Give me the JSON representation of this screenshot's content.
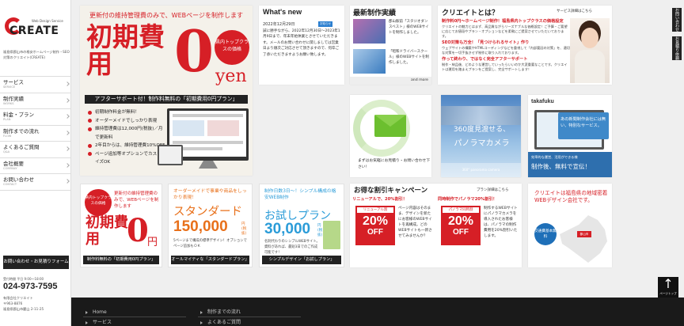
{
  "sidebar": {
    "logo_small": "Web Design Service",
    "logo_word": "CREATE",
    "tagline": "福島県郡山市の格安ホームページ制作・SEO対策のクリエイト(CREATE)",
    "nav": [
      {
        "jp": "サービス",
        "en": "SERVICE"
      },
      {
        "jp": "制作実績",
        "en": "WORKS"
      },
      {
        "jp": "料金・プラン",
        "en": "PLAN"
      },
      {
        "jp": "制作までの流れ",
        "en": "FLOW"
      },
      {
        "jp": "よくあるご質問",
        "en": "Q&A"
      },
      {
        "jp": "会社概要",
        "en": "COMPANY"
      },
      {
        "jp": "お問い合わせ",
        "en": "CONTACT"
      }
    ],
    "contact_button": "お問い合わせ・お見積りフォーム",
    "tel_hours": "受付時間 平日 9:00～18:00",
    "tel_number": "024-973-7595",
    "address": [
      "有限会社クリエイト",
      "〒963-8876",
      "福島県郡山市麓山 2-11-25"
    ]
  },
  "right_rail": {
    "tab1": "お問い合わせ",
    "tab2": "お見積り依頼",
    "pagetop_label": "ページトップ"
  },
  "hero": {
    "top": "更新付の維持管理費のみで、WEBページを制作します",
    "big": "初期費用",
    "zero": "0",
    "yen": "yen",
    "badge": "県内トップクラスの価格",
    "band": "アフターサポート付！制作料無料の「初期費用0円プラン」",
    "list": [
      "初期制作料金が無料！",
      "オーダーメイドでしっかり表現",
      "維持管理費は12,000円(税抜)／月で更新料",
      "2年目からは、維持管理費10%OFF",
      "ページ追加等オプションでカスタマイズOK"
    ]
  },
  "news": {
    "title": "What's new",
    "date": "2022年12月29日",
    "tag": "お知らせ",
    "body": "誠に勝手ながら、2022年12月30日～2023年1月9日まで、年末年始休業とさせていただきます。メールのお問い合わせに関しましては営業日より順次ご対応させて頂きますので、何卒ご了承いただきますようお願い致します。"
  },
  "works": {
    "title": "最新制作実績",
    "items": [
      "郡山駅前「スタジオダンスベスト」様のWEBサイトを制作しました。",
      "「昭和ドライバースクール」様のWEBサイトを制作しました。"
    ],
    "more": "and more"
  },
  "client": {
    "title": "クリエイトとは？",
    "link": "サービス詳細はこちら",
    "items": [
      {
        "h": "制作料0円～ホームページ制作！福島県内トップクラスの価格設定",
        "b": "クリエイトの魅力とはまず、高品質ながらリーズナブルな価格設定！ご予算・ご要望に応じてお値段やプラン・オプションなどを柔軟にご提案させていただいております。"
      },
      {
        "h": "SEO対策も万全！「見つけられるサイト」作り",
        "b": "ウェブサイトの構築やHTMLコーディングなどを重視して「内部要因の対策」を、適切な対策を一切手抜きせず制作に取り入れております。"
      },
      {
        "h": "作って終わり、ではなく完全アフターサポート",
        "b": "制作・納品後、どのような運営していったらいいのか大変重要なことです。クリエイトは運用を踏まえプランをご提案し、完全サポートします！"
      }
    ]
  },
  "mail": {
    "text": "まずはお気軽にお見積り・お問い合わせ下さい！"
  },
  "pano": {
    "line1": "360度見渡せる、",
    "line2": "パノラマカメラ",
    "foot": "360° panorama camera"
  },
  "takafuku": {
    "logo": "takafuku",
    "badge": "あの新聞制作会社には無い、特別なサービス。",
    "foot_small": "効率的な運営、活用ができる様",
    "foot_big": "制作後、無料で宣伝！"
  },
  "plans": {
    "p1": {
      "badge": "県内トップクラスの価格",
      "top": "更新付の維持管理費のみで、WEBページを制作します",
      "big": "初期費用",
      "zero": "0",
      "yen": "円",
      "foot": "制作料無料の「初期費用0円プラン」"
    },
    "p2": {
      "top": "オーダーメイドで事業や商品をしっかり表現！",
      "name": "スタンダード",
      "price": "150,000",
      "unit": "円(税抜)",
      "desc": "5ページまで構成の標準デザイン！オプションでページ追加もＯＫ",
      "foot": "オールマイティな「スタンダードプラン」"
    },
    "p3": {
      "top": "制作日数3日～！シンプル構成の格安WEB制作",
      "name": "お試しプラン",
      "price": "30,000",
      "unit": "円(税抜)",
      "desc": "名刺代わりのシンプルWEBサイト。資料があれば、最短3日でのご作成可能です！",
      "foot": "シンプルデザイン「お試しプラン」"
    }
  },
  "campaign": {
    "title": "お得な割引キャンペーン",
    "link": "プラン詳細はこちら",
    "left": {
      "h": "リニューアルで、20%割引！",
      "tag": "リニューアル割",
      "num": "20%",
      "off": "OFF",
      "desc": "ページ内容はそのまま、デザインを新たにお客様のWEBサイトを再構成。どのWEBサイトも一新させてみませんか？"
    },
    "right": {
      "h": "同時制作でパノラマ20%割引！",
      "tag": "パノラマ同時割",
      "num": "20%",
      "off": "OFF",
      "desc": "制作するWEBサイトにパノラマカメラを導入されたお客様は、パノラマの制作費用を20%割引いたします。"
    }
  },
  "area": {
    "text": "クリエイトは福島県の地域密着WEBデザイン会社です。",
    "badge": "交通費基本無料",
    "pin": "郡山市"
  },
  "footer": {
    "col1": [
      "Home",
      "サービス"
    ],
    "col2": [
      "制作までの流れ",
      "よくあるご質問"
    ]
  },
  "colors": {
    "accent": "#d61f26",
    "orange": "#e8701a",
    "blue": "#2b9cd8",
    "dark": "#222222"
  }
}
